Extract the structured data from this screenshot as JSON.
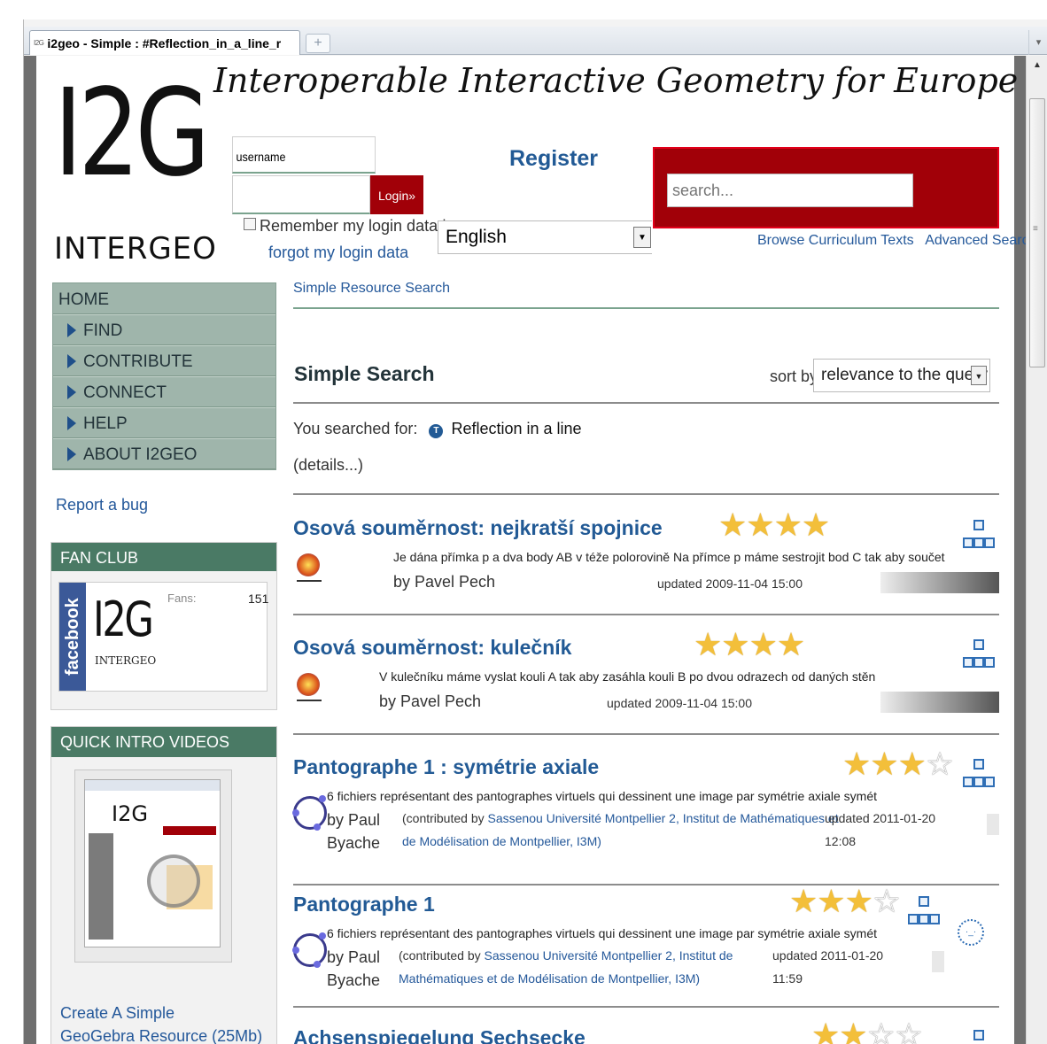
{
  "browser": {
    "tab_favicon": "I2G",
    "tab_title": "i2geo - Simple : #Reflection_in_a_line_r",
    "new_tab": "+",
    "tab_menu": "▾"
  },
  "header": {
    "logo": "I2G",
    "logo_sub": "INTERGEO",
    "tagline": "Interoperable Interactive Geometry for Europe",
    "username_value": "username",
    "login_label": "Login»",
    "remember_label": "Remember my login data |",
    "forgot_label": "forgot my login data",
    "register_label": "Register",
    "language": "English",
    "search_placeholder": "search...",
    "browse_link": "Browse Curriculum Texts",
    "advanced_link": "Advanced Search"
  },
  "sidebar": {
    "home": "HOME",
    "items": [
      {
        "label": "FIND"
      },
      {
        "label": "CONTRIBUTE"
      },
      {
        "label": "CONNECT"
      },
      {
        "label": "HELP"
      },
      {
        "label": "ABOUT I2GEO"
      }
    ],
    "report_bug": "Report a bug",
    "fan_club": {
      "title": "FAN CLUB",
      "facebook": "facebook",
      "logo": "I2G",
      "logo_sub": "INTERGEO",
      "fans_label": "Fans:",
      "fans_count": "151"
    },
    "quick_intro": {
      "title": "QUICK INTRO VIDEOS",
      "video_logo": "I2G",
      "link_line1": "Create A Simple",
      "link_line2": "GeoGebra Resource (25Mb)"
    }
  },
  "main": {
    "breadcrumb": "Simple Resource Search",
    "title": "Simple Search",
    "sort_label": "sort by",
    "sort_value": "relevance to the query",
    "you_searched": "You searched for:",
    "topic_badge": "T",
    "query": "Reflection in a line",
    "details": "(details...)",
    "results": [
      {
        "title": "Osová souměrnost: nejkratší spojnice",
        "rating": 4,
        "description": "Je dána přímka p a dva body AB v téže polorovině Na přímce p máme sestrojit bod C tak aby součet",
        "author": "by Pavel Pech",
        "updated": "updated 2009-11-04 15:00"
      },
      {
        "title": "Osová souměrnost: kulečník",
        "rating": 4,
        "description": "V kulečníku máme vyslat kouli A tak aby zasáhla kouli B po dvou odrazech od daných stěn",
        "author": "by Pavel Pech",
        "updated": "updated 2009-11-04 15:00"
      },
      {
        "title": "Pantographe 1 : symétrie axiale",
        "rating": 3,
        "description": "6 fichiers représentant des pantographes virtuels qui dessinent une image par symétrie axiale symét",
        "author_line1": "by Paul",
        "author_line2": "Byache",
        "contrib_prefix": "(contributed by",
        "contrib_link1": "Sassenou Université Montpellier 2, Institut de Mathématiques et",
        "contrib_link2": "de Modélisation de Montpellier, I3M)",
        "updated_line1": "updated 2011-01-20",
        "updated_line2": "12:08"
      },
      {
        "title": "Pantographe 1",
        "rating": 3,
        "description": "6 fichiers représentant des pantographes virtuels qui dessinent une image par symétrie axiale symét",
        "author_line1": "by Paul",
        "author_line2": "Byache",
        "contrib_prefix": "(contributed by",
        "contrib_link1": "Sassenou Université Montpellier 2, Institut de",
        "contrib_link2": "Mathématiques et de Modélisation de Montpellier, I3M)",
        "updated_line1": "updated 2011-01-20",
        "updated_line2": "11:59"
      },
      {
        "title": "Achsenspiegelung Sechsecke",
        "rating": 2
      }
    ]
  },
  "icons": {
    "star_on": "★",
    "star_off": "☆",
    "scroll_up": "▲",
    "scroll_grip": "≡",
    "select_arrow": "▼"
  }
}
